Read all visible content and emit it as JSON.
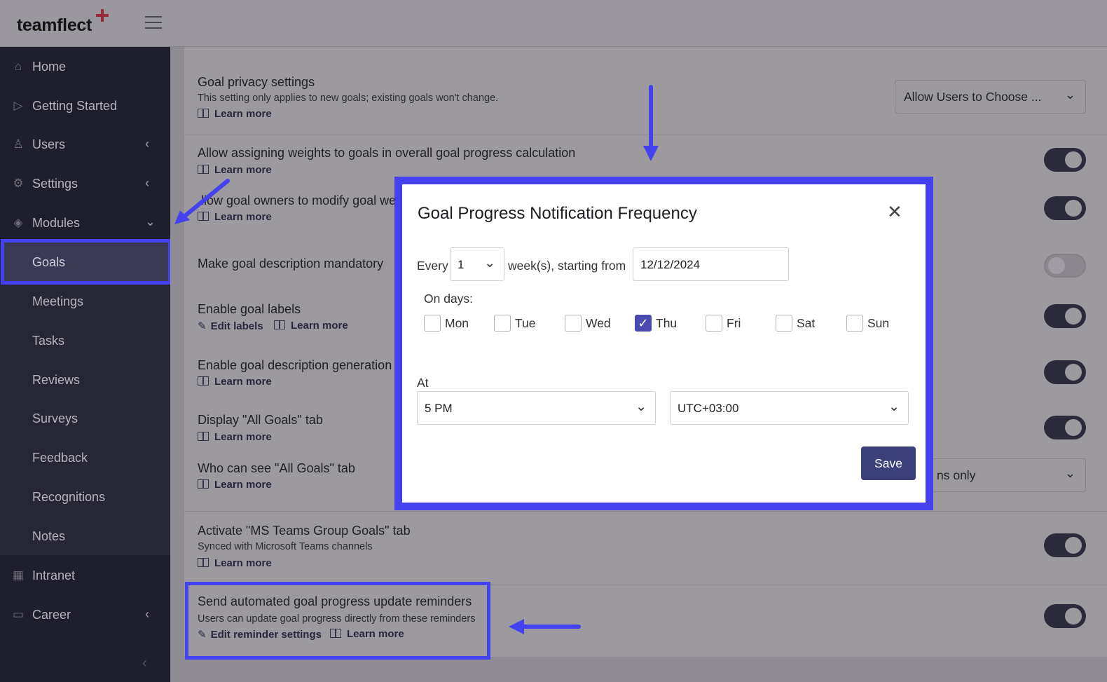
{
  "app": {
    "logo": "teamflect"
  },
  "sidebar": {
    "items": [
      {
        "label": "Home"
      },
      {
        "label": "Getting Started"
      },
      {
        "label": "Users"
      },
      {
        "label": "Settings"
      },
      {
        "label": "Modules"
      }
    ],
    "modules_sub": [
      {
        "label": "Goals"
      },
      {
        "label": "Meetings"
      },
      {
        "label": "Tasks"
      },
      {
        "label": "Reviews"
      },
      {
        "label": "Surveys"
      },
      {
        "label": "Feedback"
      },
      {
        "label": "Recognitions"
      },
      {
        "label": "Notes"
      }
    ],
    "bottom_items": [
      {
        "label": "Intranet"
      },
      {
        "label": "Career"
      }
    ]
  },
  "settings": {
    "learn_more": "Learn more",
    "privacy": {
      "title": "Goal privacy settings",
      "desc": "This setting only applies to new goals; existing goals won't change.",
      "select": "Allow Users to Choose ..."
    },
    "weights": {
      "title": "Allow assigning weights to goals in overall goal progress calculation"
    },
    "owners": {
      "title": "llow goal owners to modify goal we"
    },
    "description_mandatory": {
      "title": "Make goal description mandatory"
    },
    "labels": {
      "title": "Enable goal labels",
      "edit": "Edit labels"
    },
    "generation": {
      "title": "Enable goal description generation w"
    },
    "all_goals_tab": {
      "title": "Display \"All Goals\" tab"
    },
    "who_can_see": {
      "title": "Who can see \"All Goals\" tab",
      "select": "ns only"
    },
    "ms_teams": {
      "title": "Activate \"MS Teams Group Goals\" tab",
      "desc": "Synced with Microsoft Teams channels"
    },
    "reminders": {
      "title": "Send automated goal progress update reminders",
      "desc": "Users can update goal progress directly from these reminders",
      "edit": "Edit reminder settings"
    }
  },
  "modal": {
    "title": "Goal Progress Notification Frequency",
    "every_label": "Every",
    "every_value": "1",
    "weeks_label": "week(s), starting from",
    "start_date": "12/12/2024",
    "on_days_label": "On days:",
    "days": [
      {
        "label": "Mon",
        "checked": false
      },
      {
        "label": "Tue",
        "checked": false
      },
      {
        "label": "Wed",
        "checked": false
      },
      {
        "label": "Thu",
        "checked": true
      },
      {
        "label": "Fri",
        "checked": false
      },
      {
        "label": "Sat",
        "checked": false
      },
      {
        "label": "Sun",
        "checked": false
      }
    ],
    "at_label": "At",
    "time_value": "5 PM",
    "timezone_value": "UTC+03:00",
    "save_label": "Save"
  },
  "colors": {
    "highlight": "#4541f0",
    "sidebar": "#1e1e2c",
    "save": "#3b3f7a"
  }
}
